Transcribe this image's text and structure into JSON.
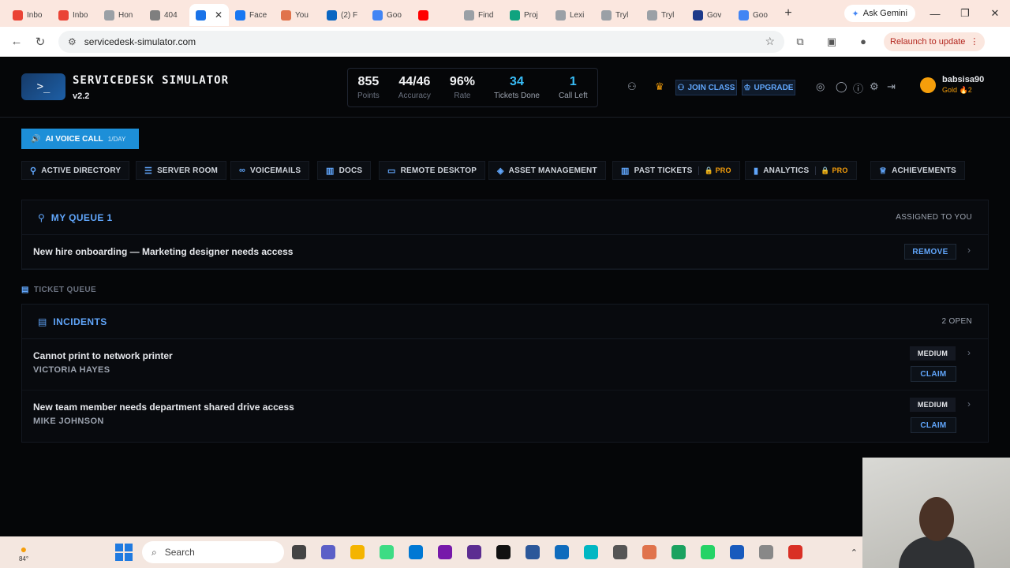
{
  "browser": {
    "tabs": [
      {
        "label": "Inbo",
        "color": "#ea4335"
      },
      {
        "label": "Inbo",
        "color": "#ea4335"
      },
      {
        "label": "Hon",
        "color": "#9aa0a6"
      },
      {
        "label": "404",
        "color": "#7f7f7f"
      },
      {
        "label": "",
        "color": "#1a73e8",
        "active": true
      },
      {
        "label": "Face",
        "color": "#1877f2"
      },
      {
        "label": "You",
        "color": "#e0734c"
      },
      {
        "label": "(2) F",
        "color": "#0a66c2"
      },
      {
        "label": "Goo",
        "color": "#4285f4"
      },
      {
        "label": "",
        "color": "#ff0000"
      },
      {
        "label": "Find",
        "color": "#9aa0a6"
      },
      {
        "label": "Proj",
        "color": "#10a37f"
      },
      {
        "label": "Lexi",
        "color": "#9aa0a6"
      },
      {
        "label": "Tryl",
        "color": "#9aa0a6"
      },
      {
        "label": "Tryl",
        "color": "#9aa0a6"
      },
      {
        "label": "Gov",
        "color": "#1e3a8a"
      },
      {
        "label": "Goo",
        "color": "#4285f4"
      }
    ],
    "ask_gemini": "Ask Gemini",
    "url": "servicedesk-simulator.com",
    "relaunch": "Relaunch to update"
  },
  "app": {
    "title": "SERVICEDESK SIMULATOR",
    "version": "v2.2",
    "stats": [
      {
        "value": "855",
        "label": "Points"
      },
      {
        "value": "44/46",
        "label": "Accuracy"
      },
      {
        "value": "96%",
        "label": "Rate"
      },
      {
        "value": "34",
        "label": "Tickets Done",
        "highlight": true
      },
      {
        "value": "1",
        "label": "Call Left",
        "highlight": true
      }
    ],
    "join_class": "JOIN CLASS",
    "upgrade": "UPGRADE",
    "user": {
      "name": "babsisa90",
      "rank": "Gold",
      "streak": "2"
    }
  },
  "voice_call": {
    "label": "AI VOICE CALL",
    "quota": "1/DAY"
  },
  "tools": [
    {
      "label": "ACTIVE DIRECTORY",
      "icon": "person-icon"
    },
    {
      "label": "SERVER ROOM",
      "icon": "server-icon"
    },
    {
      "label": "VOICEMAILS",
      "icon": "voicemail-icon"
    },
    {
      "label": "DOCS",
      "icon": "book-icon"
    },
    {
      "label": "REMOTE DESKTOP",
      "icon": "monitor-icon"
    },
    {
      "label": "ASSET MANAGEMENT",
      "icon": "cube-icon"
    },
    {
      "label": "PAST TICKETS",
      "icon": "book-icon",
      "pro": "PRO"
    },
    {
      "label": "ANALYTICS",
      "icon": "bar-chart-icon",
      "pro": "PRO"
    },
    {
      "label": "ACHIEVEMENTS",
      "icon": "trophy-icon"
    }
  ],
  "my_queue": {
    "title": "MY QUEUE 1",
    "right": "ASSIGNED TO YOU",
    "tickets": [
      {
        "title": "New hire onboarding — Marketing designer needs access",
        "action": "REMOVE"
      }
    ]
  },
  "ticket_queue_label": "TICKET QUEUE",
  "incidents": {
    "title": "INCIDENTS",
    "right": "2 OPEN",
    "tickets": [
      {
        "title": "Cannot print to network printer",
        "requester": "VICTORIA HAYES",
        "severity": "MEDIUM",
        "action": "CLAIM"
      },
      {
        "title": "New team member needs department shared drive access",
        "requester": "MIKE JOHNSON",
        "severity": "MEDIUM",
        "action": "CLAIM"
      }
    ]
  },
  "taskbar": {
    "search": "Search",
    "weather": "84°"
  }
}
